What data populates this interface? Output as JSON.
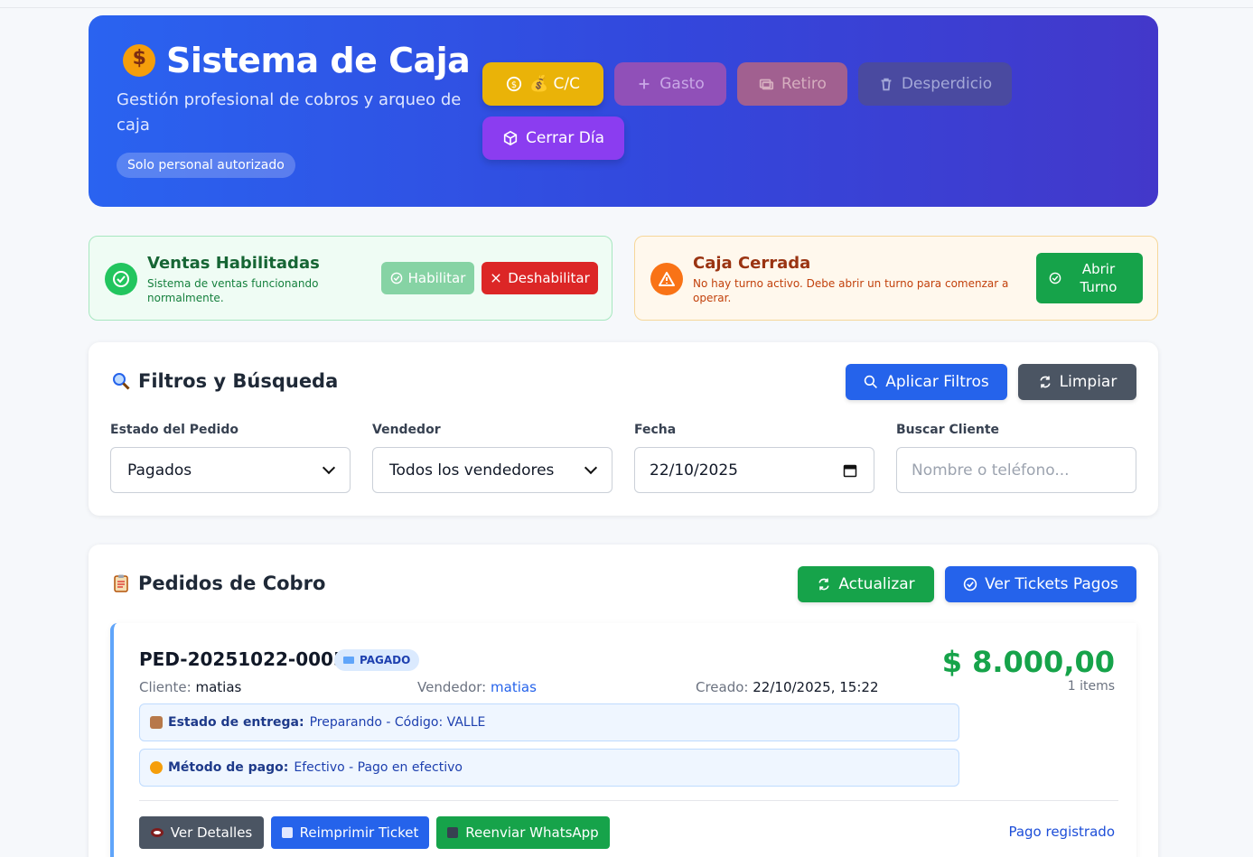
{
  "header": {
    "title": "Sistema de Caja",
    "subtitle": "Gestión profesional de cobros y arqueo de caja",
    "badge": "Solo personal autorizado",
    "buttons": {
      "cc": "💰 C/C",
      "gasto": "Gasto",
      "retiro": "Retiro",
      "desperdicio": "Desperdicio",
      "cerrar_dia": "Cerrar Día"
    }
  },
  "sales_status": {
    "title": "Ventas Habilitadas",
    "description": "Sistema de ventas funcionando normalmente.",
    "enable_label": "Habilitar",
    "disable_label": "Deshabilitar"
  },
  "cash_status": {
    "title": "Caja Cerrada",
    "description": "No hay turno activo. Debe abrir un turno para comenzar a operar.",
    "open_label": "Abrir Turno"
  },
  "filters": {
    "title": "Filtros y Búsqueda",
    "apply_label": "Aplicar Filtros",
    "clear_label": "Limpiar",
    "estado_label": "Estado del Pedido",
    "estado_value": "Pagados",
    "vendedor_label": "Vendedor",
    "vendedor_value": "Todos los vendedores",
    "fecha_label": "Fecha",
    "fecha_value": "22/10/2025",
    "cliente_label": "Buscar Cliente",
    "cliente_placeholder": "Nombre o teléfono..."
  },
  "orders": {
    "title": "Pedidos de Cobro",
    "refresh_label": "Actualizar",
    "tickets_label": "Ver Tickets Pagos",
    "items": [
      {
        "id": "PED-20251022-0005",
        "status": "PAGADO",
        "amount": "$ 8.000,00",
        "items_count": "1 items",
        "cliente_label": "Cliente:",
        "cliente": "matias",
        "vendedor_label": "Vendedor:",
        "vendedor": "matias",
        "creado_label": "Creado:",
        "creado": "22/10/2025, 15:22",
        "entrega_label": "Estado de entrega:",
        "entrega": "Preparando - Código: VALLE",
        "pago_label": "Método de pago:",
        "pago": "Efectivo - Pago en efectivo",
        "details_label": "Ver Detalles",
        "reprint_label": "Reimprimir Ticket",
        "whatsapp_label": "Reenviar WhatsApp",
        "payment_status": "Pago registrado"
      }
    ]
  },
  "colors": {
    "primary": "#2563eb",
    "success": "#16a34a",
    "danger": "#dc2626",
    "warning": "#f97316",
    "accent": "#eab308"
  }
}
